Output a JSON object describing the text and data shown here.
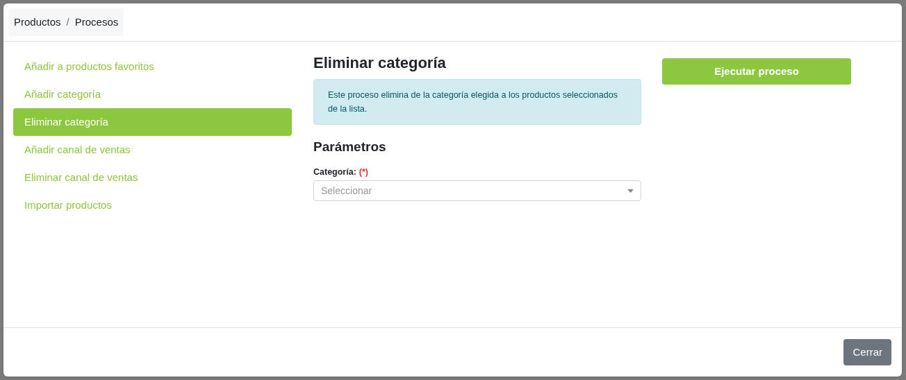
{
  "breadcrumb": [
    "Productos",
    "Procesos"
  ],
  "breadcrumb_separator": "/",
  "menu": [
    {
      "label": "Añadir a productos favoritos",
      "selected": false
    },
    {
      "label": "Añadir categoría",
      "selected": false
    },
    {
      "label": "Eliminar categoría",
      "selected": true
    },
    {
      "label": "Añadir canal de ventas",
      "selected": false
    },
    {
      "label": "Eliminar canal de ventas",
      "selected": false
    },
    {
      "label": "Importar productos",
      "selected": false
    }
  ],
  "process": {
    "title": "Eliminar categoría",
    "info": "Este proceso elimina de la categoría elegida a los productos seleccionados de la lista.",
    "parameters_title": "Parámetros",
    "field": {
      "label": "Categoría:",
      "required_mark": "(*)",
      "placeholder": "Seleccionar"
    },
    "run_button": "Ejecutar proceso"
  },
  "footer": {
    "close_button": "Cerrar"
  }
}
